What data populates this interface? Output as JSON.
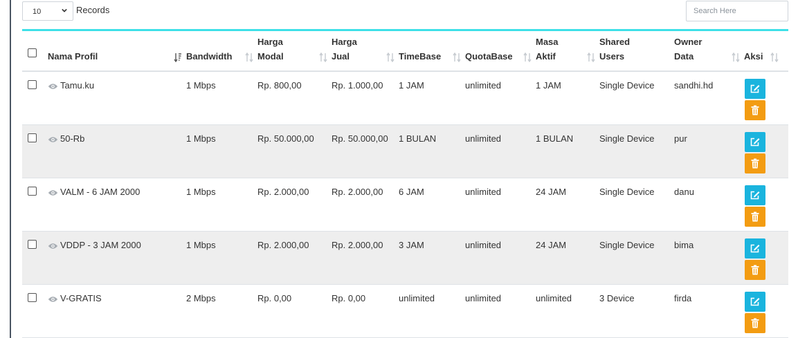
{
  "controls": {
    "page_length": "10",
    "records_label": "Records",
    "search_placeholder": "Search Here"
  },
  "columns": [
    {
      "line1": "Nama Profil",
      "line2": ""
    },
    {
      "line1": "Bandwidth",
      "line2": ""
    },
    {
      "line1": "Harga",
      "line2": "Modal"
    },
    {
      "line1": "Harga",
      "line2": "Jual"
    },
    {
      "line1": "TimeBase",
      "line2": ""
    },
    {
      "line1": "QuotaBase",
      "line2": ""
    },
    {
      "line1": "Masa",
      "line2": "Aktif"
    },
    {
      "line1": "Shared",
      "line2": "Users"
    },
    {
      "line1": "Owner",
      "line2": "Data"
    },
    {
      "line1": "Aksi",
      "line2": ""
    }
  ],
  "rows": [
    {
      "name": "Tamu.ku",
      "bandwidth": "1 Mbps",
      "harga_modal": "Rp. 800,00",
      "harga_jual": "Rp. 1.000,00",
      "timebase": "1 JAM",
      "quotabase": "unlimited",
      "masa_aktif": "1 JAM",
      "shared_users": "Single Device",
      "owner": "sandhi.hd"
    },
    {
      "name": "50-Rb",
      "bandwidth": "1 Mbps",
      "harga_modal": "Rp. 50.000,00",
      "harga_jual": "Rp. 50.000,00",
      "timebase": "1 BULAN",
      "quotabase": "unlimited",
      "masa_aktif": "1 BULAN",
      "shared_users": "Single Device",
      "owner": "pur"
    },
    {
      "name": "VALM - 6 JAM 2000",
      "bandwidth": "1 Mbps",
      "harga_modal": "Rp. 2.000,00",
      "harga_jual": "Rp. 2.000,00",
      "timebase": "6 JAM",
      "quotabase": "unlimited",
      "masa_aktif": "24 JAM",
      "shared_users": "Single Device",
      "owner": "danu"
    },
    {
      "name": "VDDP - 3 JAM 2000",
      "bandwidth": "1 Mbps",
      "harga_modal": "Rp. 2.000,00",
      "harga_jual": "Rp. 2.000,00",
      "timebase": "3 JAM",
      "quotabase": "unlimited",
      "masa_aktif": "24 JAM",
      "shared_users": "Single Device",
      "owner": "bima"
    },
    {
      "name": "V-GRATIS",
      "bandwidth": "2 Mbps",
      "harga_modal": "Rp. 0,00",
      "harga_jual": "Rp. 0,00",
      "timebase": "unlimited",
      "quotabase": "unlimited",
      "masa_aktif": "unlimited",
      "shared_users": "3 Device",
      "owner": "firda"
    }
  ],
  "icons": {
    "edit": "edit-icon",
    "delete": "trash-icon",
    "view": "eye-icon",
    "sort": "sort-icon"
  },
  "colors": {
    "accent_border": "#3ee0e8",
    "edit_button": "#1ab4de",
    "delete_button": "#f39c12",
    "stripe": "#eeeeee"
  }
}
